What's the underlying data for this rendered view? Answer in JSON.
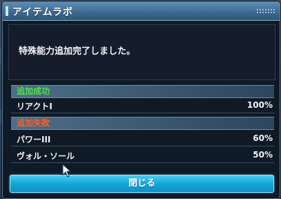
{
  "window": {
    "title": "アイテムラボ"
  },
  "message": "特殊能力追加完了しました。",
  "success_section": {
    "label": "追加成功",
    "color": "#4fe04a",
    "items": [
      {
        "name": "リアクトI",
        "rate": "100%"
      }
    ]
  },
  "failure_section": {
    "label": "追加失敗",
    "color": "#f2622e",
    "items": [
      {
        "name": "パワーIII",
        "rate": "60%"
      },
      {
        "name": "ヴォル・ソール",
        "rate": "50%"
      }
    ]
  },
  "close_button": {
    "label": "閉じる",
    "color": "#14a6d8"
  },
  "icons": [
    "mouse-cursor-icon"
  ]
}
